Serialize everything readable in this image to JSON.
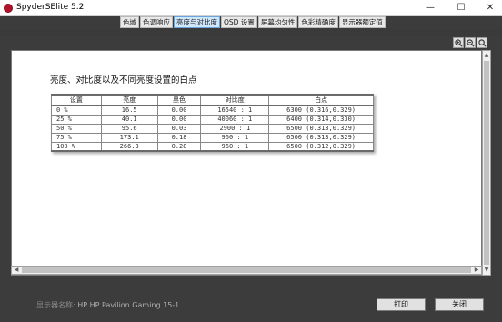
{
  "window": {
    "title": "SpyderSElite 5.2",
    "minimize": "—",
    "maximize": "☐",
    "close": "✕"
  },
  "tabs": [
    "色域",
    "色调响应",
    "亮度与对比度",
    "OSD 设置",
    "屏幕均匀性",
    "色彩精确度",
    "显示器额定值"
  ],
  "active_tab_index": 2,
  "zoom_tools": [
    "zoom-in-icon",
    "zoom-out-icon",
    "zoom-fit-icon"
  ],
  "report": {
    "heading": "亮度、对比度以及不同亮度设置的白点",
    "columns": [
      "设置",
      "亮度",
      "黑色",
      "对比度",
      "白点"
    ],
    "rows": [
      {
        "setting": "0 %",
        "brightness": "16.5",
        "black": "0.00",
        "contrast": "16540 : 1",
        "whitepoint": "6300 (0.316,0.329)"
      },
      {
        "setting": "25 %",
        "brightness": "40.1",
        "black": "0.00",
        "contrast": "40060 : 1",
        "whitepoint": "6400 (0.314,0.330)"
      },
      {
        "setting": "50 %",
        "brightness": "95.6",
        "black": "0.03",
        "contrast": "2900 : 1",
        "whitepoint": "6500 (0.313,0.329)"
      },
      {
        "setting": "75 %",
        "brightness": "173.1",
        "black": "0.18",
        "contrast": "960 : 1",
        "whitepoint": "6500 (0.313,0.329)"
      },
      {
        "setting": "100 %",
        "brightness": "266.3",
        "black": "0.28",
        "contrast": "960 : 1",
        "whitepoint": "6500 (0.312,0.329)"
      }
    ]
  },
  "footer": {
    "display_label": "显示器名称:",
    "display_value": "HP HP Pavilion Gaming 15-1",
    "print_button": "打印",
    "close_button": "关闭"
  },
  "colors": {
    "background": "#3c3c3c",
    "active_tab": "#cfe6fb",
    "app_icon": "#b4122a"
  }
}
